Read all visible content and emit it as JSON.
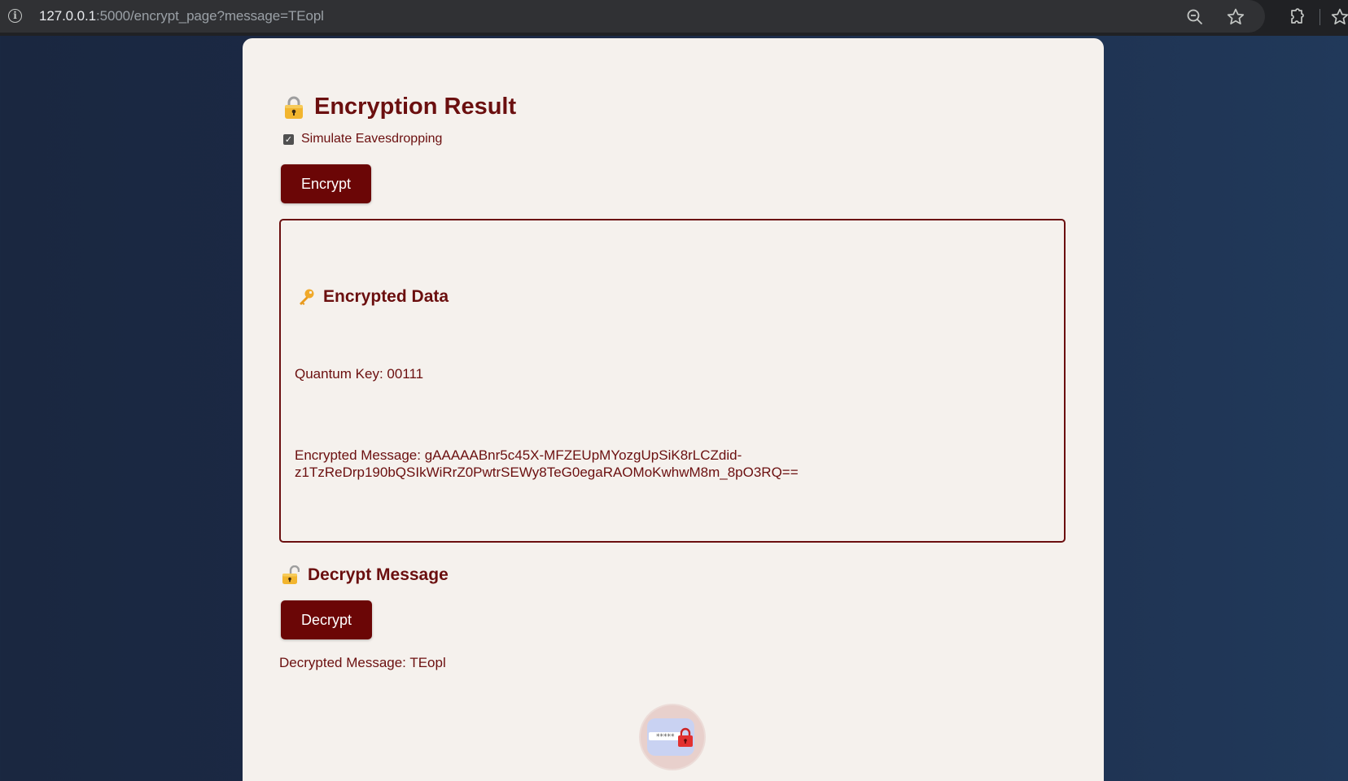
{
  "browser": {
    "url_host": "127.0.0.1",
    "url_rest": ":5000/encrypt_page?message=TEopl",
    "icons": [
      "info-icon",
      "zoom-out-icon",
      "bookmark-star-icon",
      "extensions-icon",
      "reading-list-icon"
    ]
  },
  "page": {
    "title": "Encryption Result",
    "title_icon": "lock-icon",
    "checkbox_label": "Simulate Eavesdropping",
    "checkbox_checked": true,
    "encrypt_label": "Encrypt",
    "encrypted_data": {
      "heading": "Encrypted Data",
      "heading_icon": "key-icon",
      "quantum_key": "Quantum Key: 00111",
      "encrypted_message": "Encrypted Message: gAAAAABnr5c45X-MFZEUpMYozgUpSiK8rLCZdid-z1TzReDrp190bQSIkWiRrZ0PwtrSEWy8TeG0egaRAOMoKwhwM8m_8pO3RQ=="
    },
    "decrypt_heading": "Decrypt Message",
    "decrypt_heading_icon": "unlock-icon",
    "decrypt_label": "Decrypt",
    "decrypted_message": "Decrypted Message: TEopl",
    "footer_logo": "password-lock-logo"
  },
  "colors": {
    "accent": "#6b0f0f",
    "button": "#6b0606",
    "card_bg": "#f5f1ed",
    "page_bg": "#1c2b48"
  }
}
